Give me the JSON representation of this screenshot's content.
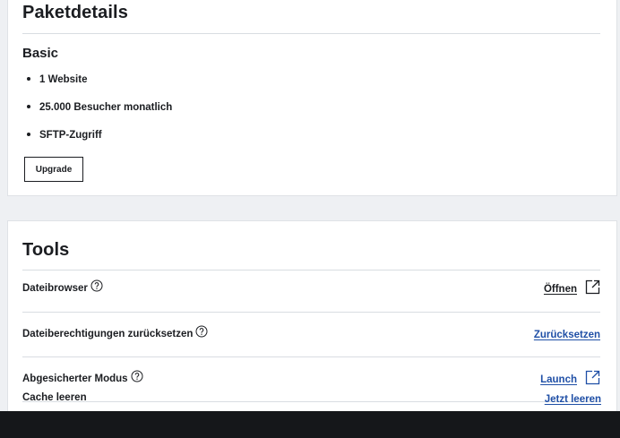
{
  "package": {
    "title": "Paketdetails",
    "plan": "Basic",
    "features": [
      "1 Website",
      "25.000 Besucher monatlich",
      "SFTP-Zugriff"
    ],
    "upgrade_label": "Upgrade"
  },
  "tools": {
    "title": "Tools",
    "rows": [
      {
        "label": "Dateibrowser",
        "action": "Öffnen",
        "action_icon": "external-link-icon",
        "has_help": true
      },
      {
        "label": "Dateiberechtigungen zurücksetzen",
        "action": "Zurücksetzen",
        "has_help": true
      },
      {
        "label": "Abgesicherter Modus",
        "action": "Launch",
        "action_icon": "external-link-icon",
        "has_help": true
      },
      {
        "label": "Cache leeren",
        "action": "Jetzt leeren",
        "has_help": false
      }
    ]
  },
  "colors": {
    "link_blue": "#1f4fa6",
    "text": "#1b1d21",
    "page_bg": "#eef0f3",
    "bottom_bar": "#15171a"
  }
}
